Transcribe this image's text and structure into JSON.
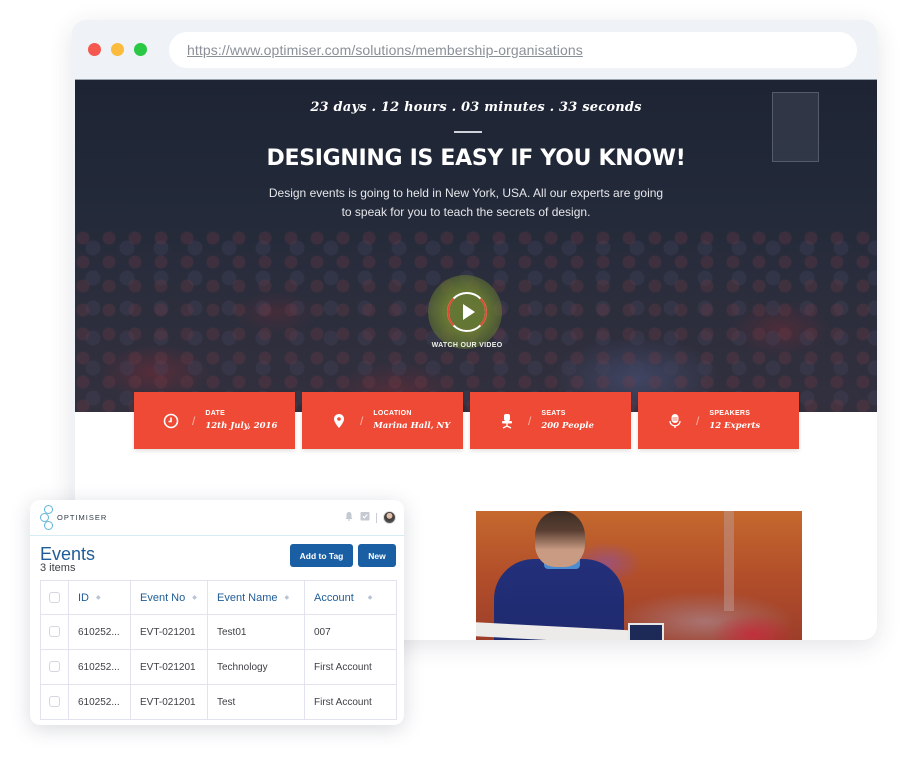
{
  "browser": {
    "url": "https://www.optimiser.com/solutions/membership-organisations",
    "window_controls": [
      "close",
      "minimize",
      "maximize"
    ]
  },
  "hero": {
    "countdown": "23 days . 12 hours . 03 minutes . 33 seconds",
    "headline": "DESIGNING IS EASY IF YOU KNOW!",
    "subtext": "Design events is going to held in New York, USA. All our experts are going to speak for you to teach the secrets of design.",
    "video_label": "WATCH OUR VIDEO",
    "accent_color": "#ee4a35"
  },
  "info_cards": [
    {
      "icon": "clock-icon",
      "label": "DATE",
      "value": "12th July, 2016"
    },
    {
      "icon": "map-pin-icon",
      "label": "LOCATION",
      "value": "Marina Hall, NY"
    },
    {
      "icon": "chair-icon",
      "label": "SEATS",
      "value": "200 People"
    },
    {
      "icon": "microphone-icon",
      "label": "SPEAKERS",
      "value": "12 Experts"
    }
  ],
  "crm_panel": {
    "logo_text": "OPTIMISER",
    "header_icons": [
      "bell-icon",
      "task-check-icon",
      "user-avatar"
    ],
    "title": "Events",
    "count": "3 items",
    "buttons": {
      "add_to_tag": "Add to Tag",
      "new": "New"
    },
    "brand_color": "#1a5fa3",
    "table": {
      "columns": [
        "ID",
        "Event No",
        "Event Name",
        "Account"
      ],
      "rows": [
        {
          "id": "610252...",
          "event_no": "EVT-021201",
          "event_name": "Test01",
          "account": "007"
        },
        {
          "id": "610252...",
          "event_no": "EVT-021201",
          "event_name": "Technology",
          "account": "First Account"
        },
        {
          "id": "610252...",
          "event_no": "EVT-021201",
          "event_name": "Test",
          "account": "First Account"
        }
      ]
    }
  }
}
